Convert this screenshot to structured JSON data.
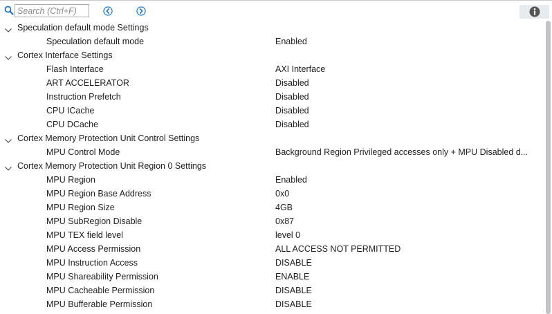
{
  "toolbar": {
    "search_placeholder": "Search (Ctrl+F)",
    "search_value": "",
    "icons": {
      "search": "magnifier-icon",
      "prev": "circle-chevron-left-icon",
      "next": "circle-chevron-right-icon",
      "info": "info-icon"
    }
  },
  "colors": {
    "accent": "#1a73c8",
    "text": "#1e1e1e",
    "info_bg": "#e6ebf0",
    "scroll_thumb": "#c2c3c9"
  },
  "groups": [
    {
      "label": "Speculation default mode Settings",
      "expanded": true,
      "items": [
        {
          "name": "Speculation default mode",
          "value": "Enabled"
        }
      ]
    },
    {
      "label": "Cortex Interface Settings",
      "expanded": true,
      "items": [
        {
          "name": "Flash Interface",
          "value": "AXI Interface"
        },
        {
          "name": "ART ACCELERATOR",
          "value": "Disabled"
        },
        {
          "name": "Instruction Prefetch",
          "value": "Disabled"
        },
        {
          "name": "CPU ICache",
          "value": "Disabled"
        },
        {
          "name": "CPU DCache",
          "value": "Disabled"
        }
      ]
    },
    {
      "label": "Cortex Memory Protection Unit Control Settings",
      "expanded": true,
      "items": [
        {
          "name": "MPU Control Mode",
          "value": "Background Region Privileged accesses only + MPU Disabled d..."
        }
      ]
    },
    {
      "label": "Cortex Memory Protection Unit Region 0 Settings",
      "expanded": true,
      "items": [
        {
          "name": "MPU Region",
          "value": "Enabled"
        },
        {
          "name": "MPU Region Base Address",
          "value": "0x0"
        },
        {
          "name": "MPU Region Size",
          "value": "4GB"
        },
        {
          "name": "MPU SubRegion Disable",
          "value": "0x87"
        },
        {
          "name": "MPU TEX field level",
          "value": "level 0"
        },
        {
          "name": "MPU Access Permission",
          "value": "ALL ACCESS NOT PERMITTED"
        },
        {
          "name": "MPU Instruction Access",
          "value": "DISABLE"
        },
        {
          "name": "MPU Shareability Permission",
          "value": "ENABLE"
        },
        {
          "name": "MPU Cacheable Permission",
          "value": "DISABLE"
        },
        {
          "name": "MPU Bufferable  Permission",
          "value": "DISABLE"
        }
      ]
    }
  ]
}
